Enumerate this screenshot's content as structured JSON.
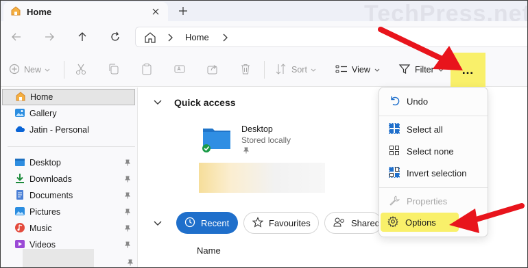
{
  "tabbar": {
    "tab_title": "Home",
    "watermark": "TechPress.net",
    "icons": {
      "home": "home-folder-icon",
      "close": "close-icon",
      "new_tab": "plus-icon"
    }
  },
  "navigation": {
    "back": "arrow-left-icon",
    "forward": "arrow-right-icon",
    "up": "arrow-up-icon",
    "refresh": "refresh-icon",
    "address": {
      "home_icon": "home-outline-icon",
      "crumb": "Home",
      "separator": "chevron-right-icon"
    }
  },
  "command_bar": {
    "new_label": "New",
    "sort_label": "Sort",
    "view_label": "View",
    "filter_label": "Filter",
    "more_label": "…",
    "highlight_color": "#f9f06a"
  },
  "sidebar": {
    "items_top": [
      {
        "label": "Home",
        "icon": "home-folder-icon",
        "selected": true
      },
      {
        "label": "Gallery",
        "icon": "gallery-icon"
      },
      {
        "label": "Jatin - Personal",
        "icon": "onedrive-cloud-icon"
      }
    ],
    "items_pinned": [
      {
        "label": "Desktop",
        "icon": "desktop-folder-icon"
      },
      {
        "label": "Downloads",
        "icon": "download-icon"
      },
      {
        "label": "Documents",
        "icon": "documents-icon"
      },
      {
        "label": "Pictures",
        "icon": "pictures-icon"
      },
      {
        "label": "Music",
        "icon": "music-icon"
      },
      {
        "label": "Videos",
        "icon": "videos-icon"
      }
    ]
  },
  "main": {
    "quick_access_title": "Quick access",
    "quick_access_item": {
      "name": "Desktop",
      "sub": "Stored locally"
    },
    "chips": {
      "recent": "Recent",
      "favourites": "Favourites",
      "shared": "Shared"
    },
    "column_name": "Name"
  },
  "menu": {
    "undo": "Undo",
    "select_all": "Select all",
    "select_none": "Select none",
    "invert_selection": "Invert selection",
    "properties": "Properties",
    "options": "Options"
  },
  "colors": {
    "accent": "#1f6fcb",
    "highlight": "#f9f06a",
    "arrow": "#e8141c"
  }
}
